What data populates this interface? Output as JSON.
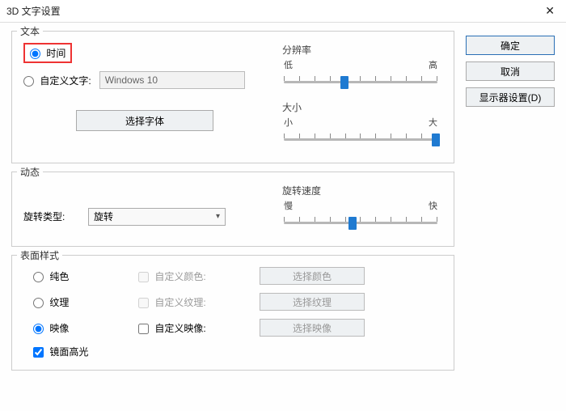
{
  "titlebar": {
    "title": "3D 文字设置"
  },
  "buttons": {
    "ok": "确定",
    "cancel": "取消",
    "display": "显示器设置(D)"
  },
  "text": {
    "legend": "文本",
    "opt_time": "时间",
    "opt_custom": "自定义文字:",
    "custom_value": "Windows 10",
    "choose_font": "选择字体",
    "resolution": {
      "label": "分辨率",
      "low": "低",
      "high": "高"
    },
    "size": {
      "label": "大小",
      "small": "小",
      "big": "大"
    }
  },
  "motion": {
    "legend": "动态",
    "spin_type_label": "旋转类型:",
    "spin_value": "旋转",
    "speed": {
      "label": "旋转速度",
      "slow": "慢",
      "fast": "快"
    }
  },
  "surface": {
    "legend": "表面样式",
    "solid": "纯色",
    "texture": "纹理",
    "image": "映像",
    "custom_color": "自定义颜色:",
    "custom_texture": "自定义纹理:",
    "custom_image": "自定义映像:",
    "choose_color": "选择颜色",
    "choose_texture": "选择纹理",
    "choose_image": "选择映像",
    "spec_highlight": "镜面高光"
  }
}
